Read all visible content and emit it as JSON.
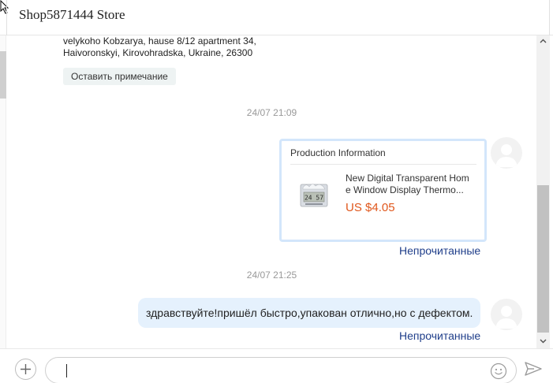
{
  "header": {
    "title": "Shop5871444 Store"
  },
  "messages": {
    "address_lines": [
      "velykoho Kobzarya, hause 8/12 apartment 34,",
      "Haivoronskyi, Kirovohradska, Ukraine, 26300"
    ],
    "note_button": "Оставить примечание",
    "timestamp_1": "24/07 21:09",
    "product_card": {
      "title": "Production Information",
      "name_line_1": "New Digital Transparent Hom",
      "name_line_2": "e Window Display Thermo...",
      "price": "US $4.05",
      "thumb_display": "24 57"
    },
    "unread_1": "Непрочитанные",
    "timestamp_2": "24/07 21:25",
    "message_text": "здравствуйте!пришёл быстро,упакован отлично,но с дефектом.",
    "unread_2": "Непрочитанные"
  },
  "composer": {
    "input_value": "",
    "add_icon": "plus-icon",
    "emoji_icon": "smiley-icon",
    "send_icon": "send-icon"
  },
  "colors": {
    "bubble": "#e5f1fd",
    "card_border": "#d3e6fb",
    "price": "#e0571c",
    "unread": "#1f3e8a"
  }
}
